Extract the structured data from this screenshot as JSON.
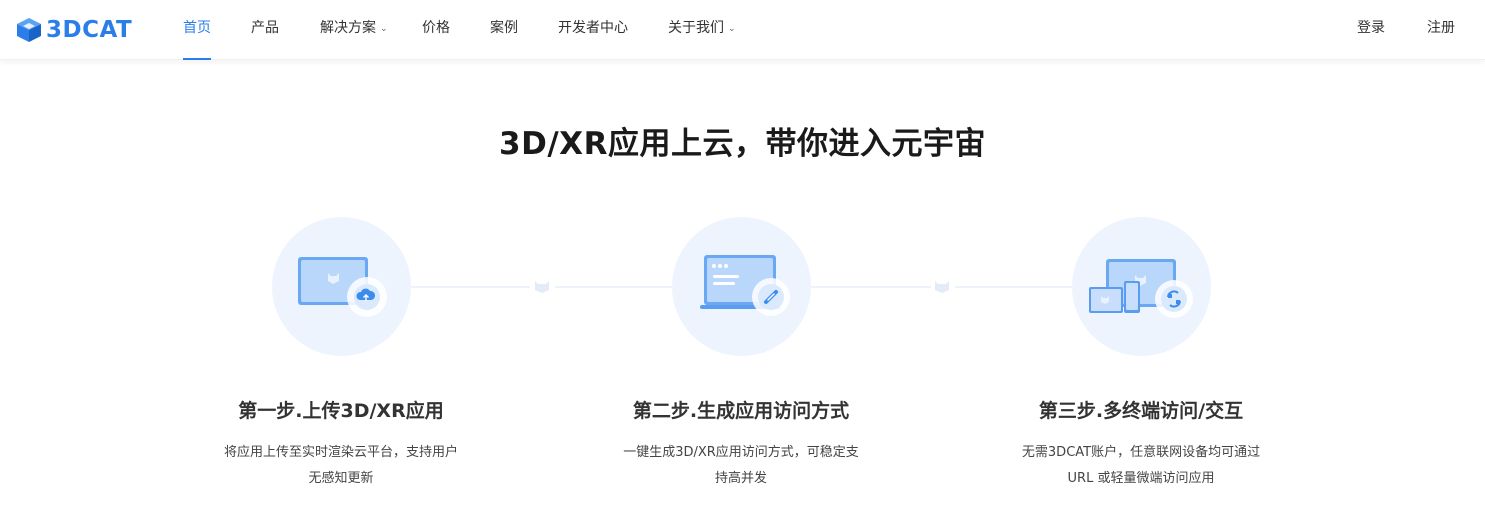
{
  "brand": {
    "name": "3DCAT",
    "color": "#2b7de9"
  },
  "nav": {
    "items": [
      {
        "label": "首页",
        "active": true
      },
      {
        "label": "产品"
      },
      {
        "label": "解决方案",
        "dropdown": true
      },
      {
        "label": "价格"
      },
      {
        "label": "案例"
      },
      {
        "label": "开发者中心"
      },
      {
        "label": "关于我们",
        "dropdown": true
      }
    ],
    "login": "登录",
    "register": "注册"
  },
  "hero": {
    "title": "3D/XR应用上云，带你进入元宇宙"
  },
  "steps": [
    {
      "title": "第一步.上传3D/XR应用",
      "desc_line1": "将应用上传至实时渲染云平台，支持用户",
      "desc_line2": "无感知更新",
      "icon": "upload-cloud-icon"
    },
    {
      "title": "第二步.生成应用访问方式",
      "desc_line1": "一键生成3D/XR应用访问方式，可稳定支",
      "desc_line2": "持高并发",
      "icon": "link-icon"
    },
    {
      "title": "第三步.多终端访问/交互",
      "desc_line1": "无需3DCAT账户，任意联网设备均可通过",
      "desc_line2": "URL 或轻量微端访问应用",
      "icon": "sync-devices-icon"
    }
  ]
}
